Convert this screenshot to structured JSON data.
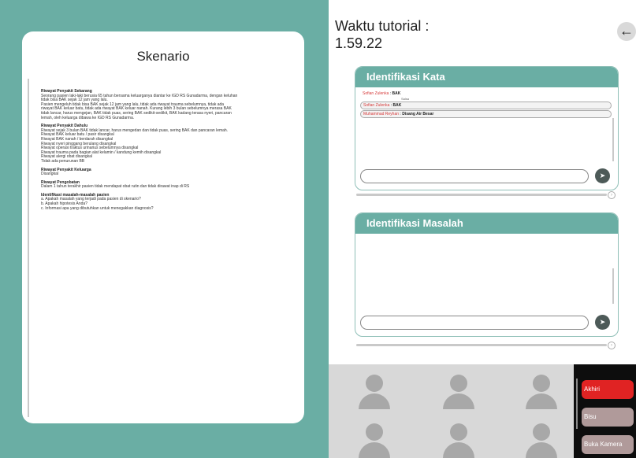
{
  "scenario": {
    "title": "Skenario",
    "sections": [
      {
        "title": "Riwayat Penyakit Sekarang",
        "lines": [
          "Seorang pasien laki-laki berusia 65 tahun bersama keluarganya diantar ke IGD RS Gunadarma, dengan keluhan",
          "tidak bisa BAK sejak 12 jam yang lalu.",
          "Pasien mengeluh tidak bisa BAK sejak 12 jam yang lalu, tidak ada riwayat trauma sebelumnya, tidak ada",
          "riwayat BAK keluar batu, tidak ada riwayat BAK keluar nanah. Kurang lebih 3 bulan sebelumnya merasa BAK",
          "tidak lancar, harus mengejan, BAK tidak puas, sering BAK sedikit-sedikit, BAK kadang terasa nyeri, pancaran",
          "lemah, oleh keluarga dibawa ke IGD RS Gunadarma."
        ]
      },
      {
        "title": "Riwayat Penyakit Dahulu",
        "lines": [
          "Riwayat sejak 3 bulan BAK tidak lancar, harus mengedan dan tidak puas, sering BAK dan pancaran lemah.",
          "Riwayat BAK keluar batu / pasir disangkal",
          "Riwayat BAK nanah / berdarah disangkal",
          "Riwayat nyeri pinggang berulang disangkal",
          "Riwayat operasi traktus urinarius sebelumnya disangkal",
          "Riwayat trauma pada bagian alat kelamin / kandung kemih disangkal",
          "Riwayat alergi obat disangkal",
          "Tidak ada penurunan BB"
        ]
      },
      {
        "title": "Riwayat Penyakit Keluarga",
        "lines": [
          "Disangkal"
        ]
      },
      {
        "title": "Riwayat Pengobatan",
        "lines": [
          "Dalam 1 tahun terakhir pasien tidak mendapat obat rutin dan tidak dirawat inap di RS"
        ]
      },
      {
        "title": "Identifikasi masalah-masalah pasien",
        "lines": [
          "a. Apakah masalah yang terjadi pada pasien di skenario?",
          "b. Apakah hipotesis Anda?",
          "c. Informasi apa yang dibutuhkan untuk menegakkan diagnosis?"
        ]
      }
    ]
  },
  "timer": {
    "label": "Waktu tutorial :",
    "value": "1.59.22"
  },
  "back_icon": "arrow-left-icon",
  "identifikasi_kata": {
    "title": "Identifikasi Kata",
    "messages": [
      {
        "name": "Sofian Zulenka",
        "sep": " : ",
        "text": "BAK",
        "sub": "Salsa"
      },
      {
        "name": "Sofian Zulenka",
        "sep": " : ",
        "text": "BAK"
      },
      {
        "name": "Muhammad Reyhan",
        "sep": " : ",
        "text": "Disang Air Besar"
      }
    ],
    "input_placeholder": "",
    "send_icon": "send-icon"
  },
  "identifikasi_masalah": {
    "title": "Identifikasi Masalah",
    "input_placeholder": "",
    "send_icon": "send-icon"
  },
  "controls": {
    "end_label": "Akhiri",
    "mute_label": "Bisu",
    "camera_label": "Buka Kamera"
  },
  "colors": {
    "primary": "#6aaea4",
    "end": "#e02323",
    "secondary_button": "#b09a9a"
  }
}
